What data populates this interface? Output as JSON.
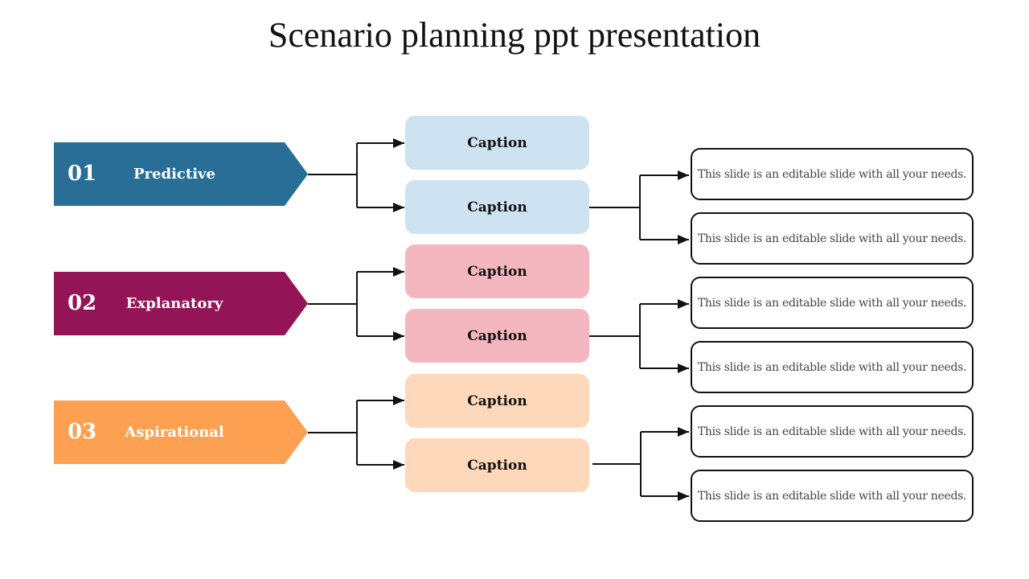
{
  "title": "Scenario planning ppt presentation",
  "scenarios": [
    {
      "number": "01",
      "label": "Predictive",
      "color": "#286E96",
      "caption_color": "#CDE3F1",
      "captions": [
        "Caption",
        "Caption"
      ]
    },
    {
      "number": "02",
      "label": "Explanatory",
      "color": "#941557",
      "caption_color": "#F5B7BF",
      "captions": [
        "Caption",
        "Caption"
      ]
    },
    {
      "number": "03",
      "label": "Aspirational",
      "color": "#FDA051",
      "caption_color": "#FDD8BB",
      "captions": [
        "Caption",
        "Caption"
      ]
    }
  ],
  "descriptions": [
    "This slide is an editable slide with all your needs.",
    "This slide is an editable slide with all your needs.",
    "This slide is an editable slide with all your needs.",
    "This slide is an editable slide with all your needs.",
    "This slide is an editable slide with all your needs.",
    "This slide is an editable slide with all your needs."
  ]
}
